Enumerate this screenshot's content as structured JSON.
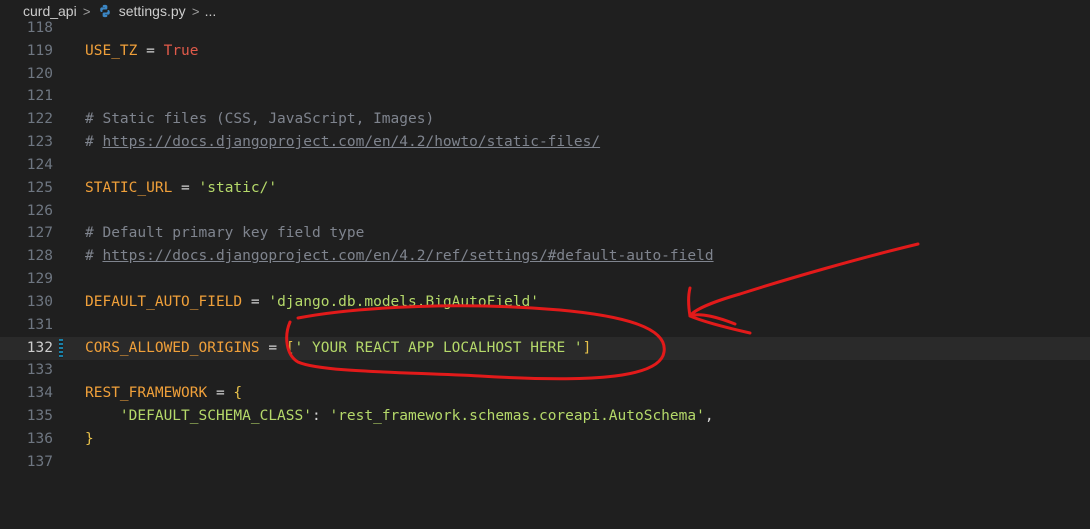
{
  "breadcrumb": {
    "folder": "curd_api",
    "separator": ">",
    "file": "settings.py",
    "ellipsis": "..."
  },
  "colors": {
    "background": "#1f1f1f",
    "line_number": "#6e7681",
    "variable": "#f0a03a",
    "keyword": "#e05a4a",
    "string": "#b5d96a",
    "comment": "#7f848e",
    "annotation": "#e21a1a"
  },
  "editor": {
    "active_line": "132",
    "lines": [
      {
        "num": "118",
        "tokens": []
      },
      {
        "num": "119",
        "tokens": [
          {
            "t": "USE_TZ",
            "c": "var"
          },
          {
            "t": " = ",
            "c": "op"
          },
          {
            "t": "True",
            "c": "kw"
          }
        ]
      },
      {
        "num": "120",
        "tokens": []
      },
      {
        "num": "121",
        "tokens": []
      },
      {
        "num": "122",
        "tokens": [
          {
            "t": "# Static files (CSS, JavaScript, Images)",
            "c": "com"
          }
        ]
      },
      {
        "num": "123",
        "tokens": [
          {
            "t": "# ",
            "c": "com"
          },
          {
            "t": "https://docs.djangoproject.com/en/4.2/howto/static-files/",
            "c": "link"
          }
        ]
      },
      {
        "num": "124",
        "tokens": []
      },
      {
        "num": "125",
        "tokens": [
          {
            "t": "STATIC_URL",
            "c": "var"
          },
          {
            "t": " = ",
            "c": "op"
          },
          {
            "t": "'static/'",
            "c": "str"
          }
        ]
      },
      {
        "num": "126",
        "tokens": []
      },
      {
        "num": "127",
        "tokens": [
          {
            "t": "# Default primary key field type",
            "c": "com"
          }
        ]
      },
      {
        "num": "128",
        "tokens": [
          {
            "t": "# ",
            "c": "com"
          },
          {
            "t": "https://docs.djangoproject.com/en/4.2/ref/settings/#default-auto-field",
            "c": "link"
          }
        ]
      },
      {
        "num": "129",
        "tokens": []
      },
      {
        "num": "130",
        "tokens": [
          {
            "t": "DEFAULT_AUTO_FIELD",
            "c": "var"
          },
          {
            "t": " = ",
            "c": "op"
          },
          {
            "t": "'django.db.models.BigAutoField'",
            "c": "str"
          }
        ]
      },
      {
        "num": "131",
        "tokens": []
      },
      {
        "num": "132",
        "tokens": [
          {
            "t": "CORS_ALLOWED_ORIGINS",
            "c": "var"
          },
          {
            "t": " = ",
            "c": "op"
          },
          {
            "t": "[",
            "c": "punc"
          },
          {
            "t": "' YOUR REACT APP LOCALHOST HERE '",
            "c": "str"
          },
          {
            "t": "]",
            "c": "punc"
          }
        ]
      },
      {
        "num": "133",
        "tokens": []
      },
      {
        "num": "134",
        "tokens": [
          {
            "t": "REST_FRAMEWORK",
            "c": "var"
          },
          {
            "t": " = ",
            "c": "op"
          },
          {
            "t": "{",
            "c": "punc"
          }
        ]
      },
      {
        "num": "135",
        "tokens": [
          {
            "t": "    ",
            "c": "norm"
          },
          {
            "t": "'DEFAULT_SCHEMA_CLASS'",
            "c": "str"
          },
          {
            "t": ": ",
            "c": "op"
          },
          {
            "t": "'rest_framework.schemas.coreapi.AutoSchema'",
            "c": "str"
          },
          {
            "t": ",",
            "c": "op"
          }
        ]
      },
      {
        "num": "136",
        "tokens": [
          {
            "t": "}",
            "c": "punc"
          }
        ]
      },
      {
        "num": "137",
        "tokens": []
      }
    ]
  }
}
